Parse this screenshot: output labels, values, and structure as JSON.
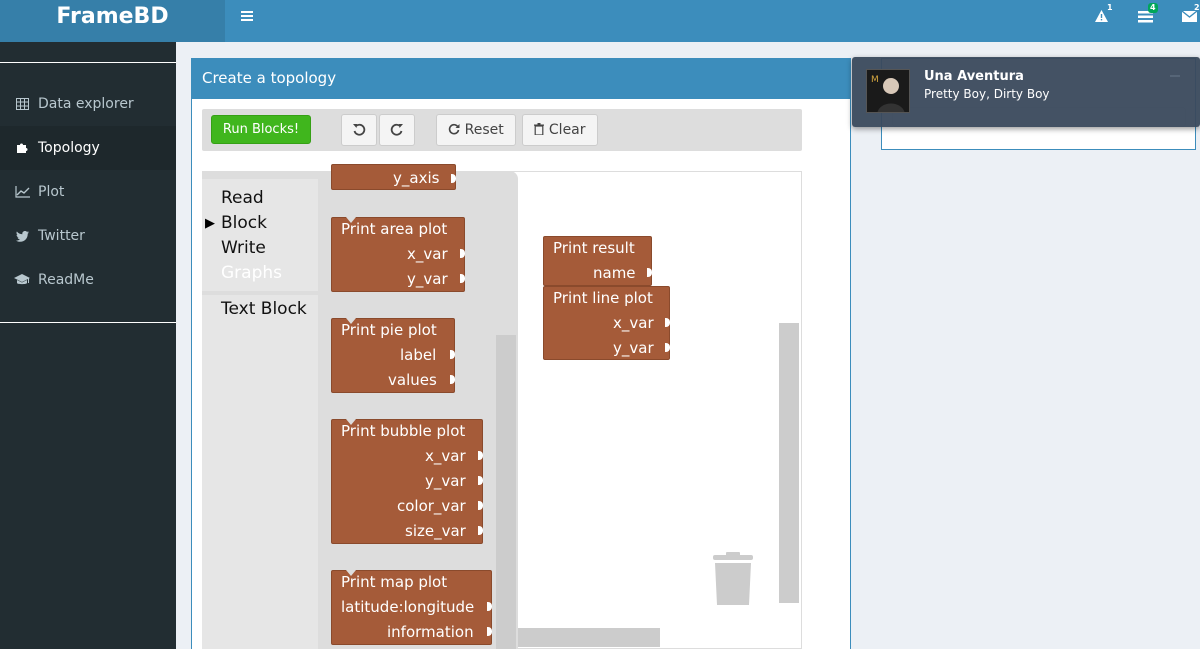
{
  "app": {
    "logo": "FrameBD"
  },
  "header": {
    "alerts_count": "1",
    "tasks_count": "4",
    "messages_count": "2"
  },
  "sidebar": {
    "items": [
      {
        "label": "Data explorer",
        "icon": "table-icon"
      },
      {
        "label": "Topology",
        "icon": "puzzle-icon"
      },
      {
        "label": "Plot",
        "icon": "line-chart-icon"
      },
      {
        "label": "Twitter",
        "icon": "twitter-icon"
      },
      {
        "label": "ReadMe",
        "icon": "graduation-cap-icon"
      }
    ]
  },
  "main": {
    "title": "Create a topology",
    "toolbar": {
      "run_label": "Run Blocks!",
      "reset_label": "Reset",
      "clear_label": "Clear"
    },
    "toolbox": {
      "categories": [
        "Read",
        "Block",
        "Write",
        "Graphs",
        "Text Block"
      ]
    },
    "flyout": {
      "partial_block": {
        "input": "y_axis"
      },
      "area": {
        "title": "Print area plot",
        "inputs": [
          "x_var",
          "y_var"
        ]
      },
      "pie": {
        "title": "Print pie plot",
        "inputs": [
          "label",
          "values"
        ]
      },
      "bubble": {
        "title": "Print bubble plot",
        "inputs": [
          "x_var",
          "y_var",
          "color_var",
          "size_var"
        ]
      },
      "map": {
        "title": "Print map plot",
        "inputs": [
          "latitude:longitude",
          "information"
        ]
      }
    },
    "canvas": {
      "result": {
        "title": "Print result",
        "inputs": [
          "name"
        ]
      },
      "line": {
        "title": "Print line plot",
        "inputs": [
          "x_var",
          "y_var"
        ]
      }
    }
  },
  "notification": {
    "title": "Una Aventura",
    "subtitle": "Pretty Boy, Dirty Boy"
  },
  "colors": {
    "header": "#3c8dbc",
    "logo_bg": "#367fa9",
    "sidebar": "#222d32",
    "block": "#a55b39",
    "run_button": "#40b61d"
  }
}
